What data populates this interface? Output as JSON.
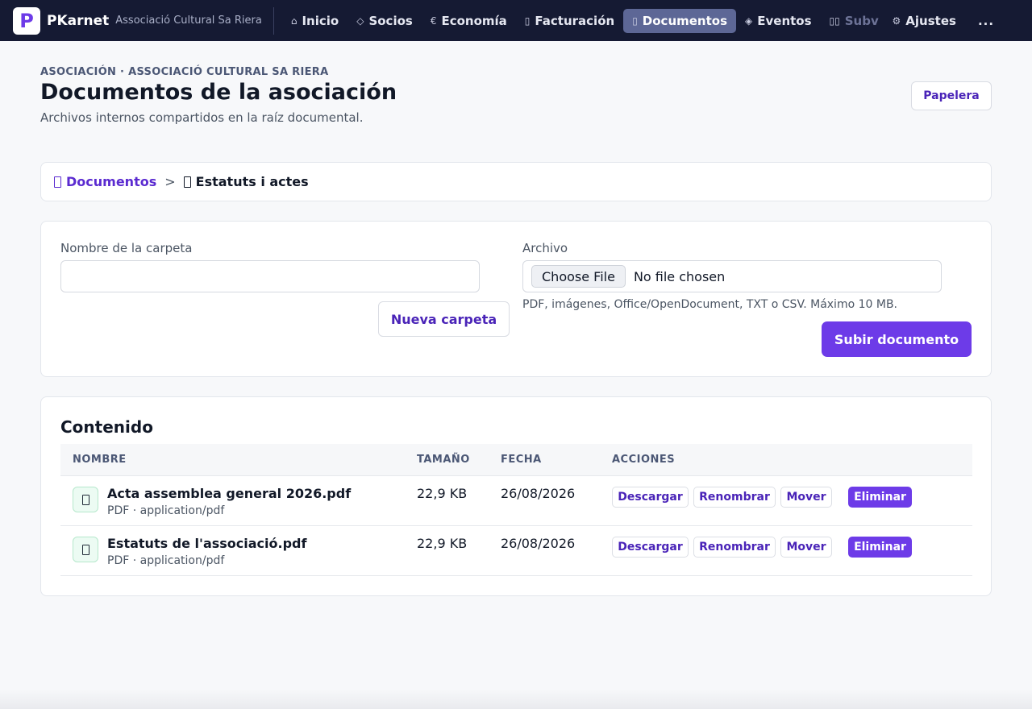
{
  "topbar": {
    "brand_letter": "P",
    "brand_name": "PKarnet",
    "org_name": "Associació Cultural Sa Riera",
    "nav": [
      {
        "icon": "⌂",
        "label": "Inicio"
      },
      {
        "icon": "◇",
        "label": "Socios"
      },
      {
        "icon": "€",
        "label": "Economía"
      },
      {
        "icon": "▯",
        "label": "Facturación"
      },
      {
        "icon": "▯",
        "label": "Documentos"
      },
      {
        "icon": "◈",
        "label": "Eventos"
      },
      {
        "icon": "▯▯",
        "label": "Subv"
      },
      {
        "icon": "⚙",
        "label": "Ajustes"
      }
    ],
    "more": "...",
    "active": "Documentos"
  },
  "header": {
    "eyebrow": "ASOCIACIÓN · ASSOCIACIÓ CULTURAL SA RIERA",
    "title": "Documentos de la asociación",
    "subtitle": "Archivos internos compartidos en la raíz documental.",
    "trash_label": "Papelera"
  },
  "breadcrumb": {
    "root": "Documentos",
    "separator": ">",
    "current": "Estatuts i actes"
  },
  "forms": {
    "folder_label": "Nombre de la carpeta",
    "folder_value": "",
    "new_folder_label": "Nueva carpeta",
    "file_label": "Archivo",
    "choose_file": "Choose File",
    "no_file": "No file chosen",
    "file_hint": "PDF, imágenes, Office/OpenDocument, TXT o CSV. Máximo 10 MB.",
    "upload_label": "Subir documento"
  },
  "content": {
    "title": "Contenido",
    "columns": [
      "NOMBRE",
      "TAMAÑO",
      "FECHA",
      "ACCIONES"
    ],
    "rows": [
      {
        "name": "Acta assemblea general 2026.pdf",
        "meta": "PDF · application/pdf",
        "size": "22,9 KB",
        "date": "26/08/2026"
      },
      {
        "name": "Estatuts de l'associació.pdf",
        "meta": "PDF · application/pdf",
        "size": "22,9 KB",
        "date": "26/08/2026"
      }
    ],
    "actions": {
      "download": "Descargar",
      "rename": "Renombrar",
      "move": "Mover",
      "delete": "Eliminar"
    }
  },
  "colors": {
    "topbar": "#151a33",
    "accent": "#6d3be8",
    "link": "#5b2bd0",
    "active_nav": "#5d6796"
  },
  "icons": {
    "home": "home-icon",
    "socios": "diamond-icon",
    "economia": "euro-icon",
    "facturacion": "invoice-icon",
    "documentos": "folder-icon",
    "eventos": "event-icon",
    "subvenciones": "grant-icon",
    "ajustes": "gear-icon",
    "file": "document-icon"
  }
}
